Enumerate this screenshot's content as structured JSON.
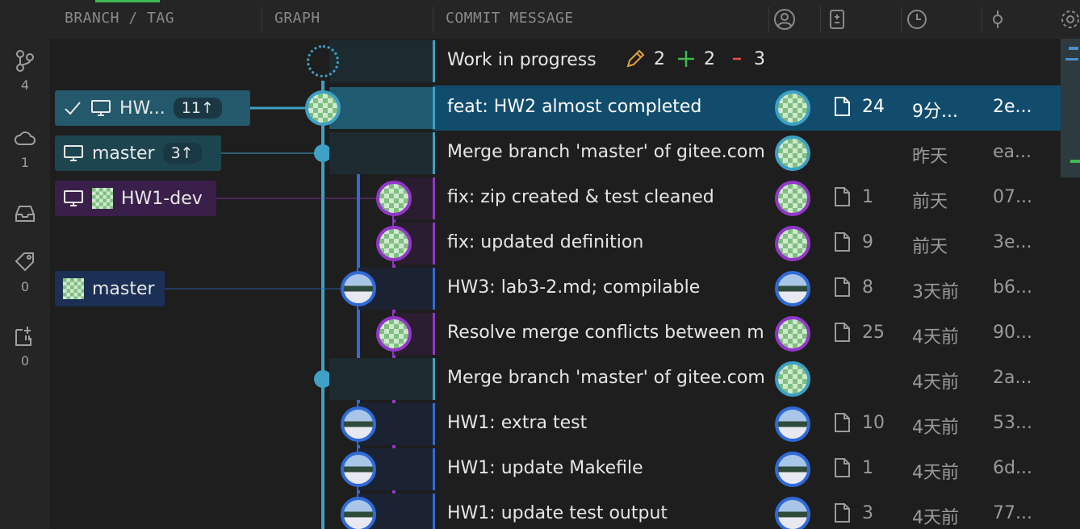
{
  "header": {
    "branch_tag": "BRANCH / TAG",
    "graph": "GRAPH",
    "commit_message": "COMMIT MESSAGE"
  },
  "activity": [
    {
      "icon": "branches-icon",
      "count": "4"
    },
    {
      "icon": "cloud-icon",
      "count": "1"
    },
    {
      "icon": "inbox-icon",
      "count": ""
    },
    {
      "icon": "tag-icon",
      "count": "0"
    },
    {
      "icon": "worktree-icon",
      "count": "0"
    }
  ],
  "wip": {
    "label": "Work in progress",
    "modified": "2",
    "added": "2",
    "deleted": "3"
  },
  "branches": {
    "hw": {
      "name": "HW...",
      "ahead": "11↑"
    },
    "master_local": {
      "name": "master",
      "ahead": "3↑"
    },
    "hw1dev": {
      "name": "HW1-dev"
    },
    "master_remote": {
      "name": "master"
    }
  },
  "commits": [
    {
      "message": "feat: HW2 almost completed",
      "files": "24",
      "date": "9分...",
      "sha": "2e..."
    },
    {
      "message": "Merge branch 'master' of gitee.com",
      "files": "",
      "date": "昨天",
      "sha": "ea..."
    },
    {
      "message": "fix: zip created & test cleaned",
      "files": "1",
      "date": "前天",
      "sha": "07..."
    },
    {
      "message": "fix: updated definition",
      "files": "9",
      "date": "前天",
      "sha": "3e..."
    },
    {
      "message": "HW3: lab3-2.md; compilable",
      "files": "8",
      "date": "3天前",
      "sha": "b6..."
    },
    {
      "message": "Resolve merge conflicts between m",
      "files": "25",
      "date": "4天前",
      "sha": "90..."
    },
    {
      "message": "Merge branch 'master' of gitee.com",
      "files": "",
      "date": "4天前",
      "sha": "2a..."
    },
    {
      "message": "HW1: extra test",
      "files": "10",
      "date": "4天前",
      "sha": "53..."
    },
    {
      "message": "HW1: update Makefile",
      "files": "1",
      "date": "4天前",
      "sha": "6d..."
    },
    {
      "message": "HW1: update test output",
      "files": "3",
      "date": "4天前",
      "sha": "77..."
    }
  ],
  "colors": {
    "teal": "#3ea0c4",
    "purple": "#9336c9",
    "blue": "#2f6ad8",
    "selected": "#124c6d"
  }
}
